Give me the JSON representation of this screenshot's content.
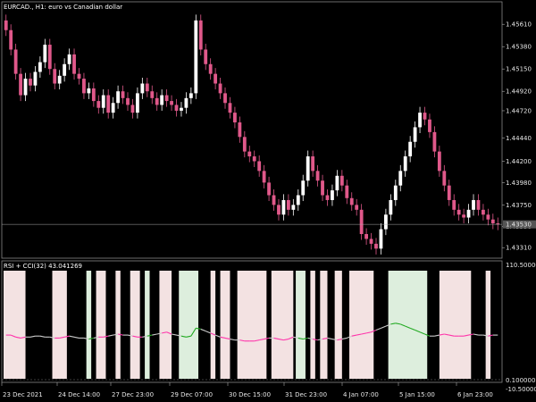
{
  "main_chart": {
    "title": "EURCAD., H1:  euro vs Canadian dollar",
    "current_price_label": "1.43530",
    "y_ticks": [
      "1.45610",
      "1.45380",
      "1.45150",
      "1.44920",
      "1.44720",
      "1.44440",
      "1.44200",
      "1.43980",
      "1.43750",
      "1.43530",
      "1.43310"
    ]
  },
  "indicator": {
    "title": "RSI + CCI(32) 43.041269",
    "y_ticks": [
      "110.500000",
      "0.100000",
      "-10.500000"
    ]
  },
  "x_ticks": [
    "23 Dec 2021",
    "24 Dec 14:00",
    "27 Dec 23:00",
    "29 Dec 07:00",
    "30 Dec 15:00",
    "31 Dec 23:00",
    "4 Jan 07:00",
    "5 Jan 15:00",
    "6 Jan 23:00"
  ],
  "colors": {
    "background": "#000000",
    "bull_candle": "#ffffff",
    "bear_candle": "#e0588a",
    "bear_zone": "#f3e2e2",
    "bull_zone": "#ddeedd",
    "rsi_bear": "#ff33aa",
    "rsi_bull": "#22aa22",
    "rsi_neutral": "#cccccc",
    "axis_text": "#e6e6e6"
  },
  "chart_data": {
    "type": "candlestick",
    "price_ylim": [
      1.4322,
      1.4575
    ],
    "closes": [
      1.4555,
      1.4535,
      1.451,
      1.4488,
      1.4505,
      1.4498,
      1.4512,
      1.4522,
      1.454,
      1.4515,
      1.45,
      1.4508,
      1.452,
      1.453,
      1.451,
      1.4505,
      1.449,
      1.4495,
      1.4482,
      1.4475,
      1.4488,
      1.447,
      1.448,
      1.4492,
      1.4485,
      1.4478,
      1.447,
      1.449,
      1.45,
      1.4492,
      1.4485,
      1.4478,
      1.4488,
      1.4482,
      1.4478,
      1.4472,
      1.4475,
      1.4485,
      1.449,
      1.4565,
      1.4535,
      1.452,
      1.451,
      1.45,
      1.449,
      1.448,
      1.447,
      1.446,
      1.4445,
      1.443,
      1.4425,
      1.442,
      1.441,
      1.4398,
      1.4385,
      1.4375,
      1.4365,
      1.438,
      1.437,
      1.4375,
      1.4385,
      1.44,
      1.4425,
      1.441,
      1.44,
      1.4385,
      1.438,
      1.439,
      1.4405,
      1.4395,
      1.4382,
      1.4375,
      1.437,
      1.4345,
      1.434,
      1.4335,
      1.433,
      1.435,
      1.4365,
      1.438,
      1.4395,
      1.441,
      1.4425,
      1.444,
      1.4455,
      1.447,
      1.4463,
      1.445,
      1.443,
      1.441,
      1.4395,
      1.438,
      1.437,
      1.4365,
      1.4362,
      1.437,
      1.438,
      1.437,
      1.4365,
      1.436,
      1.4356,
      1.4355
    ],
    "rsi_line": [
      45,
      45,
      43,
      42,
      43,
      43,
      44,
      44,
      43,
      43,
      42,
      42,
      43,
      44,
      43,
      42,
      42,
      41,
      42,
      43,
      43,
      44,
      45,
      46,
      45,
      45,
      44,
      43,
      43,
      44,
      45,
      46,
      47,
      48,
      46,
      45,
      44,
      43,
      44,
      52,
      51,
      49,
      47,
      45,
      43,
      42,
      41,
      40,
      40,
      39,
      39,
      39,
      40,
      41,
      42,
      42,
      41,
      40,
      41,
      43,
      42,
      41,
      42,
      41,
      40,
      41,
      42,
      41,
      40,
      41,
      42,
      44,
      45,
      46,
      47,
      48,
      50,
      52,
      54,
      56,
      57,
      56,
      54,
      52,
      50,
      48,
      46,
      44,
      44,
      45,
      46,
      45,
      44,
      44,
      44,
      45,
      46,
      45,
      45,
      44,
      45,
      45
    ],
    "zones": [
      {
        "start": 0.0,
        "end": 4.5,
        "type": "bear"
      },
      {
        "start": 10.0,
        "end": 13.0,
        "type": "bear"
      },
      {
        "start": 17.0,
        "end": 18.0,
        "type": "bull"
      },
      {
        "start": 19.0,
        "end": 21.0,
        "type": "bear"
      },
      {
        "start": 23.0,
        "end": 24.0,
        "type": "bear"
      },
      {
        "start": 26.0,
        "end": 28.0,
        "type": "bear"
      },
      {
        "start": 29.0,
        "end": 30.0,
        "type": "bull"
      },
      {
        "start": 32.0,
        "end": 34.5,
        "type": "bear"
      },
      {
        "start": 36.0,
        "end": 40.0,
        "type": "bull"
      },
      {
        "start": 42.5,
        "end": 43.5,
        "type": "bear"
      },
      {
        "start": 44.5,
        "end": 46.5,
        "type": "bear"
      },
      {
        "start": 48.0,
        "end": 54.0,
        "type": "bear"
      },
      {
        "start": 55.0,
        "end": 59.5,
        "type": "bear"
      },
      {
        "start": 60.0,
        "end": 62.0,
        "type": "bull"
      },
      {
        "start": 63.0,
        "end": 64.0,
        "type": "bear"
      },
      {
        "start": 65.0,
        "end": 66.5,
        "type": "bear"
      },
      {
        "start": 68.0,
        "end": 69.5,
        "type": "bear"
      },
      {
        "start": 71.0,
        "end": 76.0,
        "type": "bear"
      },
      {
        "start": 79.0,
        "end": 87.0,
        "type": "bull"
      },
      {
        "start": 89.5,
        "end": 96.0,
        "type": "bear"
      },
      {
        "start": 99.0,
        "end": 100.0,
        "type": "bear"
      }
    ]
  }
}
